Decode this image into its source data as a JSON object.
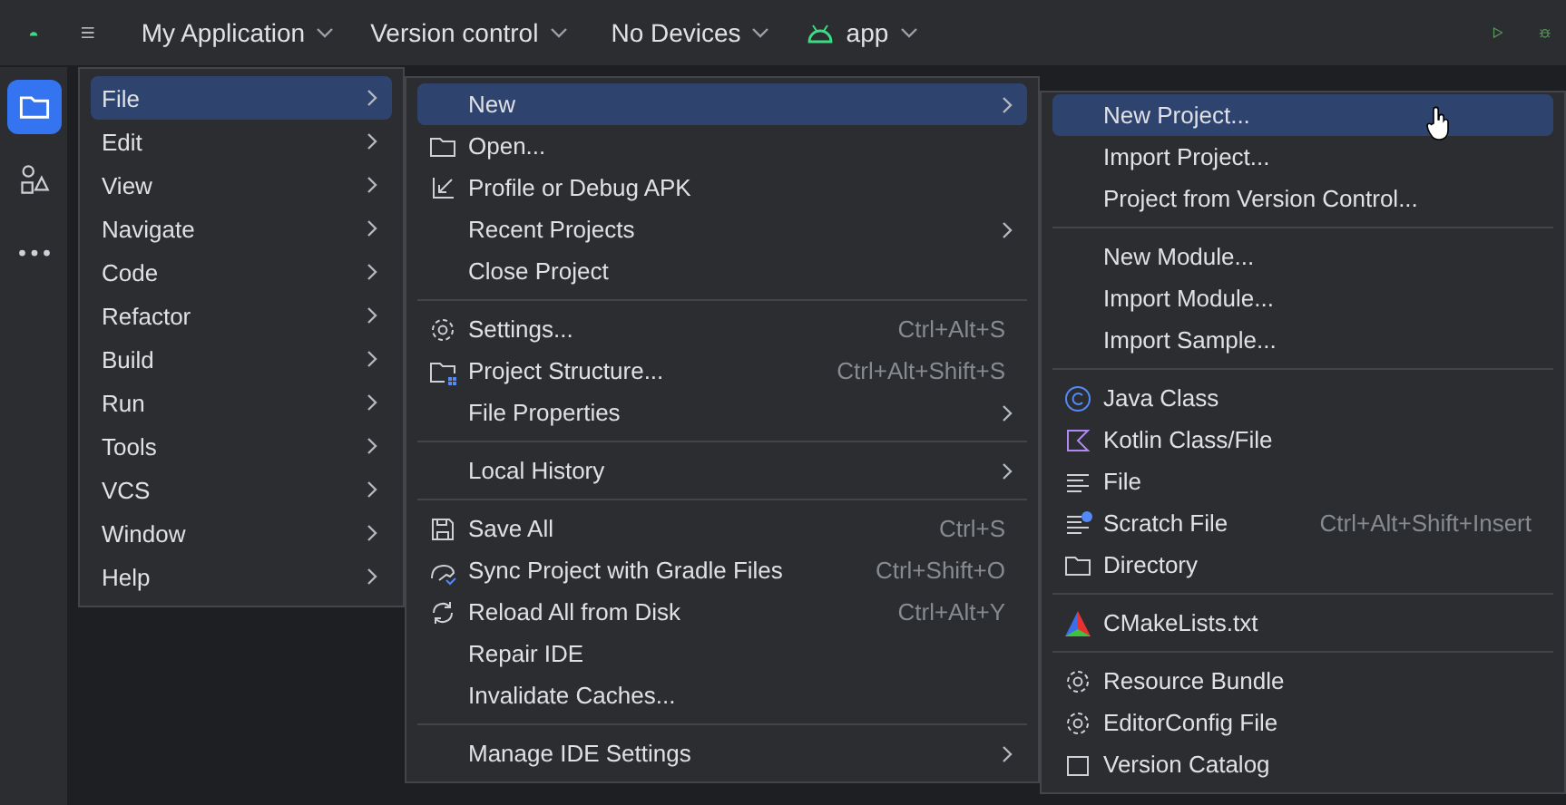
{
  "toolbar": {
    "project": "My Application",
    "vcs": "Version control",
    "device": "No Devices",
    "run_config": "app"
  },
  "side_tools": [
    {
      "selected": true
    },
    {
      "selected": false
    },
    {
      "selected": false
    }
  ],
  "main_menu": [
    {
      "label": "File",
      "selected": true
    },
    {
      "label": "Edit",
      "selected": false
    },
    {
      "label": "View",
      "selected": false
    },
    {
      "label": "Navigate",
      "selected": false
    },
    {
      "label": "Code",
      "selected": false
    },
    {
      "label": "Refactor",
      "selected": false
    },
    {
      "label": "Build",
      "selected": false
    },
    {
      "label": "Run",
      "selected": false
    },
    {
      "label": "Tools",
      "selected": false
    },
    {
      "label": "VCS",
      "selected": false
    },
    {
      "label": "Window",
      "selected": false
    },
    {
      "label": "Help",
      "selected": false
    }
  ],
  "file_menu": [
    {
      "kind": "item",
      "label": "New",
      "submenu": true,
      "selected": true
    },
    {
      "kind": "item",
      "label": "Open...",
      "submenu": false,
      "selected": false
    },
    {
      "kind": "item",
      "label": "Profile or Debug APK",
      "submenu": false,
      "selected": false
    },
    {
      "kind": "item",
      "label": "Recent Projects",
      "submenu": true,
      "selected": false
    },
    {
      "kind": "item",
      "label": "Close Project",
      "submenu": false,
      "selected": false
    },
    {
      "kind": "separator"
    },
    {
      "kind": "item",
      "label": "Settings...",
      "shortcut": "Ctrl+Alt+S",
      "submenu": false,
      "selected": false
    },
    {
      "kind": "item",
      "label": "Project Structure...",
      "shortcut": "Ctrl+Alt+Shift+S",
      "submenu": false,
      "selected": false
    },
    {
      "kind": "item",
      "label": "File Properties",
      "submenu": true,
      "selected": false
    },
    {
      "kind": "separator"
    },
    {
      "kind": "item",
      "label": "Local History",
      "submenu": true,
      "selected": false
    },
    {
      "kind": "separator"
    },
    {
      "kind": "item",
      "label": "Save All",
      "shortcut": "Ctrl+S",
      "submenu": false,
      "selected": false
    },
    {
      "kind": "item",
      "label": "Sync Project with Gradle Files",
      "shortcut": "Ctrl+Shift+O",
      "submenu": false,
      "selected": false
    },
    {
      "kind": "item",
      "label": "Reload All from Disk",
      "shortcut": "Ctrl+Alt+Y",
      "submenu": false,
      "selected": false
    },
    {
      "kind": "item",
      "label": "Repair IDE",
      "submenu": false,
      "selected": false
    },
    {
      "kind": "item",
      "label": "Invalidate Caches...",
      "submenu": false,
      "selected": false
    },
    {
      "kind": "separator"
    },
    {
      "kind": "item",
      "label": "Manage IDE Settings",
      "submenu": true,
      "selected": false
    }
  ],
  "new_menu": [
    {
      "kind": "item",
      "label": "New Project...",
      "selected": true
    },
    {
      "kind": "item",
      "label": "Import Project...",
      "selected": false
    },
    {
      "kind": "item",
      "label": "Project from Version Control...",
      "selected": false
    },
    {
      "kind": "separator"
    },
    {
      "kind": "item",
      "label": "New Module...",
      "selected": false
    },
    {
      "kind": "item",
      "label": "Import Module...",
      "selected": false
    },
    {
      "kind": "item",
      "label": "Import Sample...",
      "selected": false
    },
    {
      "kind": "separator"
    },
    {
      "kind": "item",
      "label": "Java Class",
      "selected": false
    },
    {
      "kind": "item",
      "label": "Kotlin Class/File",
      "selected": false
    },
    {
      "kind": "item",
      "label": "File",
      "selected": false
    },
    {
      "kind": "item",
      "label": "Scratch File",
      "shortcut": "Ctrl+Alt+Shift+Insert",
      "selected": false
    },
    {
      "kind": "item",
      "label": "Directory",
      "selected": false
    },
    {
      "kind": "separator"
    },
    {
      "kind": "item",
      "label": "CMakeLists.txt",
      "selected": false
    },
    {
      "kind": "separator"
    },
    {
      "kind": "item",
      "label": "Resource Bundle",
      "selected": false
    },
    {
      "kind": "item",
      "label": "EditorConfig File",
      "selected": false
    },
    {
      "kind": "item",
      "label": "Version Catalog",
      "selected": false
    }
  ]
}
